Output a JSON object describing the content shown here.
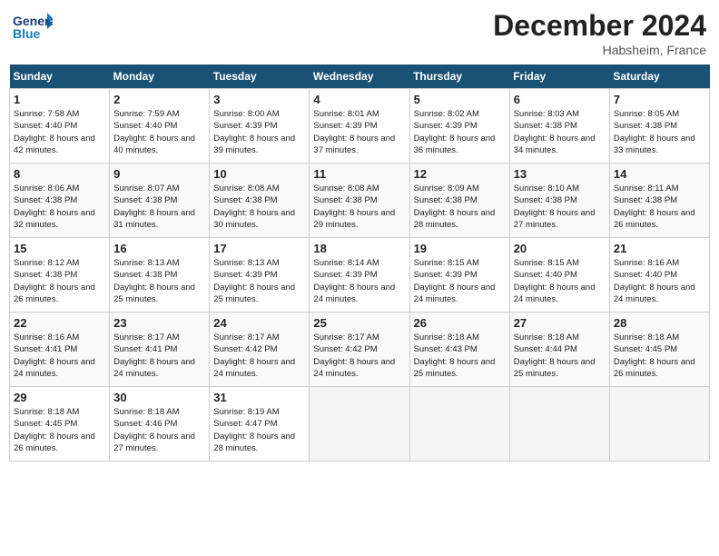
{
  "header": {
    "logo_text_general": "General",
    "logo_text_blue": "Blue",
    "month_title": "December 2024",
    "location": "Habsheim, France"
  },
  "days_of_week": [
    "Sunday",
    "Monday",
    "Tuesday",
    "Wednesday",
    "Thursday",
    "Friday",
    "Saturday"
  ],
  "weeks": [
    [
      {
        "num": "1",
        "sunrise": "7:58 AM",
        "sunset": "4:40 PM",
        "daylight": "8 hours and 42 minutes."
      },
      {
        "num": "2",
        "sunrise": "7:59 AM",
        "sunset": "4:40 PM",
        "daylight": "8 hours and 40 minutes."
      },
      {
        "num": "3",
        "sunrise": "8:00 AM",
        "sunset": "4:39 PM",
        "daylight": "8 hours and 39 minutes."
      },
      {
        "num": "4",
        "sunrise": "8:01 AM",
        "sunset": "4:39 PM",
        "daylight": "8 hours and 37 minutes."
      },
      {
        "num": "5",
        "sunrise": "8:02 AM",
        "sunset": "4:39 PM",
        "daylight": "8 hours and 36 minutes."
      },
      {
        "num": "6",
        "sunrise": "8:03 AM",
        "sunset": "4:38 PM",
        "daylight": "8 hours and 34 minutes."
      },
      {
        "num": "7",
        "sunrise": "8:05 AM",
        "sunset": "4:38 PM",
        "daylight": "8 hours and 33 minutes."
      }
    ],
    [
      {
        "num": "8",
        "sunrise": "8:06 AM",
        "sunset": "4:38 PM",
        "daylight": "8 hours and 32 minutes."
      },
      {
        "num": "9",
        "sunrise": "8:07 AM",
        "sunset": "4:38 PM",
        "daylight": "8 hours and 31 minutes."
      },
      {
        "num": "10",
        "sunrise": "8:08 AM",
        "sunset": "4:38 PM",
        "daylight": "8 hours and 30 minutes."
      },
      {
        "num": "11",
        "sunrise": "8:08 AM",
        "sunset": "4:38 PM",
        "daylight": "8 hours and 29 minutes."
      },
      {
        "num": "12",
        "sunrise": "8:09 AM",
        "sunset": "4:38 PM",
        "daylight": "8 hours and 28 minutes."
      },
      {
        "num": "13",
        "sunrise": "8:10 AM",
        "sunset": "4:38 PM",
        "daylight": "8 hours and 27 minutes."
      },
      {
        "num": "14",
        "sunrise": "8:11 AM",
        "sunset": "4:38 PM",
        "daylight": "8 hours and 26 minutes."
      }
    ],
    [
      {
        "num": "15",
        "sunrise": "8:12 AM",
        "sunset": "4:38 PM",
        "daylight": "8 hours and 26 minutes."
      },
      {
        "num": "16",
        "sunrise": "8:13 AM",
        "sunset": "4:38 PM",
        "daylight": "8 hours and 25 minutes."
      },
      {
        "num": "17",
        "sunrise": "8:13 AM",
        "sunset": "4:39 PM",
        "daylight": "8 hours and 25 minutes."
      },
      {
        "num": "18",
        "sunrise": "8:14 AM",
        "sunset": "4:39 PM",
        "daylight": "8 hours and 24 minutes."
      },
      {
        "num": "19",
        "sunrise": "8:15 AM",
        "sunset": "4:39 PM",
        "daylight": "8 hours and 24 minutes."
      },
      {
        "num": "20",
        "sunrise": "8:15 AM",
        "sunset": "4:40 PM",
        "daylight": "8 hours and 24 minutes."
      },
      {
        "num": "21",
        "sunrise": "8:16 AM",
        "sunset": "4:40 PM",
        "daylight": "8 hours and 24 minutes."
      }
    ],
    [
      {
        "num": "22",
        "sunrise": "8:16 AM",
        "sunset": "4:41 PM",
        "daylight": "8 hours and 24 minutes."
      },
      {
        "num": "23",
        "sunrise": "8:17 AM",
        "sunset": "4:41 PM",
        "daylight": "8 hours and 24 minutes."
      },
      {
        "num": "24",
        "sunrise": "8:17 AM",
        "sunset": "4:42 PM",
        "daylight": "8 hours and 24 minutes."
      },
      {
        "num": "25",
        "sunrise": "8:17 AM",
        "sunset": "4:42 PM",
        "daylight": "8 hours and 24 minutes."
      },
      {
        "num": "26",
        "sunrise": "8:18 AM",
        "sunset": "4:43 PM",
        "daylight": "8 hours and 25 minutes."
      },
      {
        "num": "27",
        "sunrise": "8:18 AM",
        "sunset": "4:44 PM",
        "daylight": "8 hours and 25 minutes."
      },
      {
        "num": "28",
        "sunrise": "8:18 AM",
        "sunset": "4:45 PM",
        "daylight": "8 hours and 26 minutes."
      }
    ],
    [
      {
        "num": "29",
        "sunrise": "8:18 AM",
        "sunset": "4:45 PM",
        "daylight": "8 hours and 26 minutes."
      },
      {
        "num": "30",
        "sunrise": "8:18 AM",
        "sunset": "4:46 PM",
        "daylight": "8 hours and 27 minutes."
      },
      {
        "num": "31",
        "sunrise": "8:19 AM",
        "sunset": "4:47 PM",
        "daylight": "8 hours and 28 minutes."
      },
      null,
      null,
      null,
      null
    ]
  ]
}
